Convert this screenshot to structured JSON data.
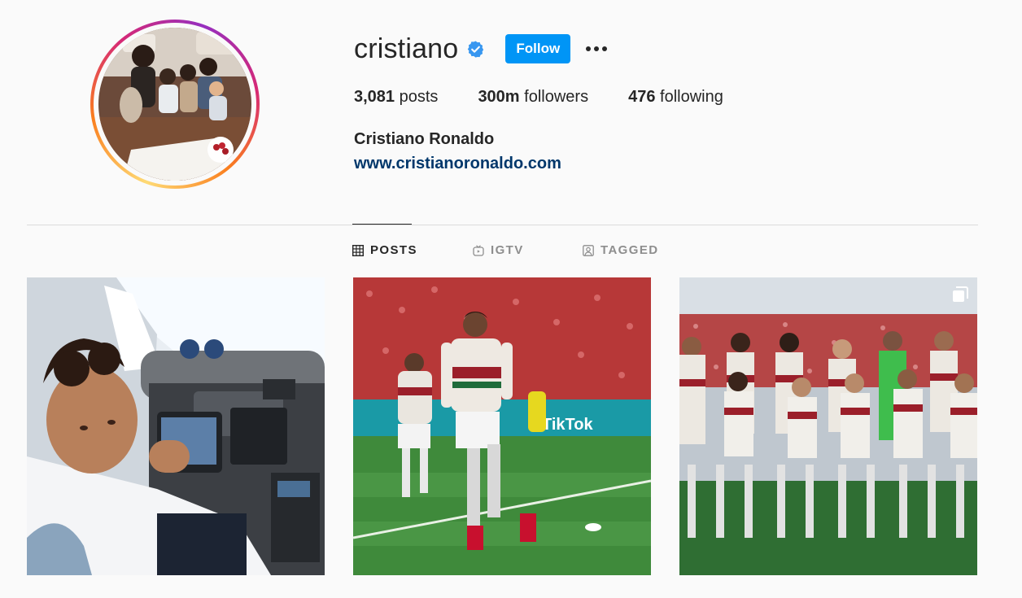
{
  "profile": {
    "username": "cristiano",
    "follow_label": "Follow",
    "stats": {
      "posts_count": "3,081",
      "posts_label": "posts",
      "followers_count": "300m",
      "followers_label": "followers",
      "following_count": "476",
      "following_label": "following"
    },
    "full_name": "Cristiano Ronaldo",
    "website": "www.cristianoronaldo.com"
  },
  "tabs": [
    {
      "label": "POSTS",
      "icon": "grid-icon",
      "active": true
    },
    {
      "label": "IGTV",
      "icon": "igtv-icon",
      "active": false
    },
    {
      "label": "TAGGED",
      "icon": "tagged-icon",
      "active": false
    }
  ],
  "posts": [
    {
      "description_icon": "photo"
    },
    {
      "description_icon": "photo"
    },
    {
      "description_icon": "photo",
      "multi": true
    }
  ],
  "colors": {
    "follow_button": "#0095f6",
    "link": "#00376b",
    "verified": "#3897f0",
    "text": "#262626",
    "muted": "#8e8e8e"
  }
}
